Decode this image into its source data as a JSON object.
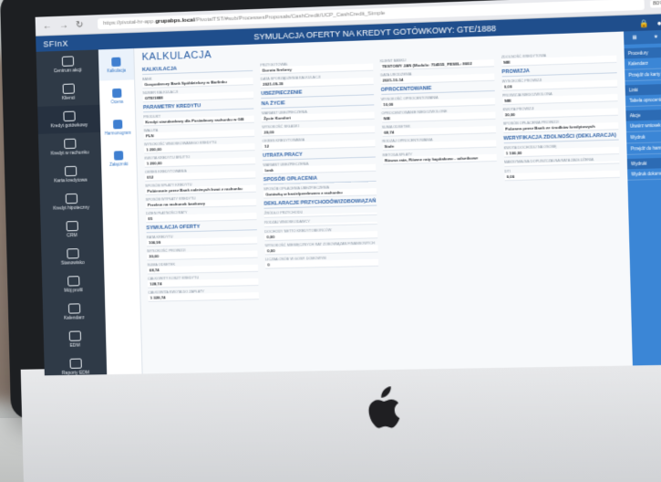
{
  "browser": {
    "url_prefix": "https://pivotal-hr-app.",
    "url_host": "grupabps.local",
    "url_rest": "/PivotalTST/#sub/ProcessesProposals/CashCredit/UCP_CashCredit_Simple",
    "zoom": "80%"
  },
  "app": {
    "brand": "SFInX",
    "title": "SYMULACJA OFERTY NA KREDYT GOTÓWKOWY: GTE/1888"
  },
  "sidebar": [
    {
      "label": "Centrum akcji",
      "icon": "dashboard-icon"
    },
    {
      "label": "Klienci",
      "icon": "person-icon"
    },
    {
      "label": "Kredyt gotówkowy",
      "icon": "money-icon"
    },
    {
      "label": "Kredyt w rachunku",
      "icon": "money-icon"
    },
    {
      "label": "Karta kredytowa",
      "icon": "card-icon"
    },
    {
      "label": "Kredyt hipoteczny",
      "icon": "house-icon"
    },
    {
      "label": "CRM",
      "icon": "crm-icon"
    },
    {
      "label": "Stanowisko",
      "icon": "desk-icon"
    },
    {
      "label": "Mój profil",
      "icon": "user-icon"
    },
    {
      "label": "Kalendarz",
      "icon": "calendar-icon"
    },
    {
      "label": "EDM",
      "icon": "edm-icon"
    },
    {
      "label": "Raporty EDM",
      "icon": "report-icon"
    }
  ],
  "subnav": [
    {
      "label": "Kalkulacja",
      "icon": "calculator-icon"
    },
    {
      "label": "Ocena",
      "icon": "doc-icon"
    },
    {
      "label": "Harmonogram",
      "icon": "calendar-icon"
    },
    {
      "label": "Załączniki",
      "icon": "paperclip-icon"
    }
  ],
  "page_title": "KALKULACJA",
  "col1": {
    "section": "KALKULACJA",
    "fields": [
      {
        "label": "BANK",
        "value": "Gospodarczy Bank Spółdzielczy w Barlinku"
      },
      {
        "label": "NUMER KALKULACJI",
        "value": "GTE/1888"
      }
    ],
    "section2": "PARAMETRY KREDYTU",
    "fields2": [
      {
        "label": "PRODUKT",
        "value": "Kredyt standardowy dla Posiadaczy rachunku w GB"
      },
      {
        "label": "WALUTA",
        "value": "PLN"
      },
      {
        "label": "WYSOKOŚĆ WNIOSKOWANEGO KREDYTU",
        "value": "1 200,00"
      },
      {
        "label": "KWOTA KREDYTU BRUTTO",
        "value": "1 200,00"
      },
      {
        "label": "OKRES KREDYTOWANIA",
        "value": "012"
      },
      {
        "label": "SPOSÓB SPŁATY KREDYTU",
        "value": "Pobieranie przez Bank należnych kwot z rachunku"
      },
      {
        "label": "SPOSÓB WYPŁATY KREDYTU",
        "value": "Przelew na rachunek bankowy"
      },
      {
        "label": "DZIEŃ PŁATNOŚCI RATY",
        "value": "05"
      }
    ],
    "section3": "SYMULACJA OFERTY",
    "fields3": [
      {
        "label": "RATA KREDYTU",
        "value": "106,99"
      },
      {
        "label": "WYSOKOŚĆ PROWIZJI",
        "value": "30,00"
      },
      {
        "label": "SUMA ODSETEK",
        "value": "68,74"
      },
      {
        "label": "CAŁKOWITY KOSZT KREDYTU",
        "value": "128,74"
      },
      {
        "label": "CAŁKOWITA KWOTA DO ZAPŁATY",
        "value": "1 328,74"
      }
    ]
  },
  "col2": {
    "fields": [
      {
        "label": "PRZYGOTOWAŁ",
        "value": "Dorota Srebrny"
      },
      {
        "label": "DATA SPORZĄDZENIA KALKULACJI",
        "value": "2021-09-30"
      }
    ],
    "section": "UBEZPIECZENIE",
    "sub1": "NA ŻYCIE",
    "fields2": [
      {
        "label": "WARIANT UBEZPIECZENIA",
        "value": "Życie Komfort"
      },
      {
        "label": "WYSOKOŚĆ SKŁADKI",
        "value": "20,00"
      },
      {
        "label": "OKRES KREDYTOWANIA",
        "value": "12"
      }
    ],
    "sub2": "UTRATA PRACY",
    "fields3": [
      {
        "label": "WARIANT UBEZPIECZENIA",
        "value": "brak"
      }
    ],
    "sub3": "SPOSÓB OPŁACENIA",
    "fields4": [
      {
        "label": "SPOSÓB OPŁACENIA UBEZPIECZENIA",
        "value": "Gotówką w kasie/przelewem z rachunku"
      }
    ],
    "section2": "DEKLARACJE PRZYCHODÓW/ZOBOWIĄZAŃ",
    "fields5": [
      {
        "label": "ŹRÓDŁO PRZYCHODU",
        "value": ""
      },
      {
        "label": "RODZAJ WNIOSKODAWCY",
        "value": ""
      },
      {
        "label": "DOCHODY NETTO KREDYTOBIORCÓW",
        "value": "0,00"
      },
      {
        "label": "WYSOKOŚĆ MIESIĘCZNYCH RAT ZOBOWIĄZAŃ FINANSOWYCH",
        "value": "0,00"
      },
      {
        "label": "LICZBA OSÓB W GOSP. DOMOWYM",
        "value": "0"
      }
    ]
  },
  "col3": {
    "fields": [
      {
        "label": "KLIENT BANKU",
        "value": "TESTOWY JAN (Modulo: 754555_PESEL: 8602"
      },
      {
        "label": "DATA URODZENIA",
        "value": "2021-10-14"
      }
    ],
    "section": "OPROCENTOWANIE",
    "fields2": [
      {
        "label": "WYSOKOŚĆ OPROCENTOWANIA",
        "value": "10,00"
      },
      {
        "label": "OPROCENTOWANIE NIEDOZWOLONE",
        "value": "NIE"
      },
      {
        "label": "SUMA ODSETEK",
        "value": "68,74"
      },
      {
        "label": "RODZAJ OPROCENTOWANIA",
        "value": "Stałe"
      },
      {
        "label": "METODA SPŁATY",
        "value": "Równa rata, Równe raty kapitałowo - odsetkowe"
      }
    ]
  },
  "col4": {
    "fields": [
      {
        "label": "ZDOLNOŚĆ KREDYTOWA",
        "value": "NIE"
      }
    ],
    "section": "PROWIZJA",
    "fields2": [
      {
        "label": "WYSOKOŚĆ PROWIZJI",
        "value": "0,00"
      },
      {
        "label": "PROWIZJA NIEDOZWOLONA",
        "value": "NIE"
      },
      {
        "label": "KWOTA PROWIZJI",
        "value": "30,00"
      },
      {
        "label": "SPOSÓB OPŁACENIA PROWIZJI",
        "value": "Pobrana przez Bank ze środków kredytowych"
      }
    ],
    "section2": "WERYFIKACJA ZDOLNOŚCI (DEKLARACJA)",
    "fields3": [
      {
        "label": "KWOTA DOCHODU NA OSOBĘ",
        "value": "1 100,00"
      },
      {
        "label": "MAKSYMALNA DOPUSZCZALNA RATA ZADŁUŻENIA",
        "value": ""
      },
      {
        "label": "DTI",
        "value": "0,00"
      }
    ]
  },
  "rpanel": {
    "items": [
      {
        "type": "head",
        "label": "Procedury"
      },
      {
        "type": "item",
        "label": "Kalendarz"
      },
      {
        "type": "item",
        "label": "Przejdź do karty klienta"
      },
      {
        "type": "head",
        "label": "Linki"
      },
      {
        "type": "item",
        "label": "Tabela oprocentowania"
      },
      {
        "type": "head",
        "label": "Akcje"
      },
      {
        "type": "item",
        "label": "Utwórz wniosek"
      },
      {
        "type": "item",
        "label": "Wydruk"
      },
      {
        "type": "item",
        "label": "Przejdź do harmonogramu"
      },
      {
        "type": "head",
        "label": "Wydruki"
      },
      {
        "type": "item",
        "label": "Wydruk dokumentów"
      }
    ]
  }
}
